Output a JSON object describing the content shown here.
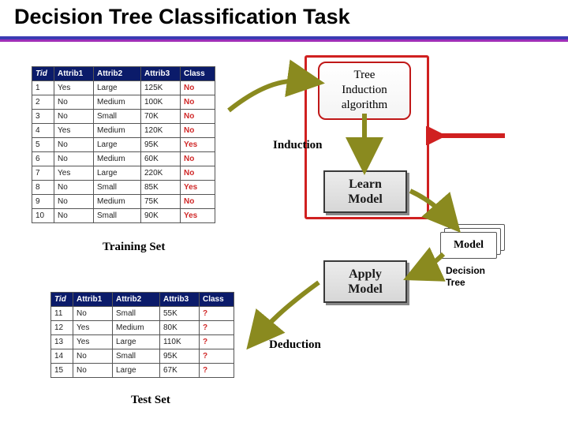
{
  "title": "Decision Tree Classification Task",
  "headers": {
    "tid": "Tid",
    "a1": "Attrib1",
    "a2": "Attrib2",
    "a3": "Attrib3",
    "cls": "Class"
  },
  "training": {
    "caption": "Training Set",
    "rows": [
      {
        "tid": "1",
        "a1": "Yes",
        "a2": "Large",
        "a3": "125K",
        "cls": "No"
      },
      {
        "tid": "2",
        "a1": "No",
        "a2": "Medium",
        "a3": "100K",
        "cls": "No"
      },
      {
        "tid": "3",
        "a1": "No",
        "a2": "Small",
        "a3": "70K",
        "cls": "No"
      },
      {
        "tid": "4",
        "a1": "Yes",
        "a2": "Medium",
        "a3": "120K",
        "cls": "No"
      },
      {
        "tid": "5",
        "a1": "No",
        "a2": "Large",
        "a3": "95K",
        "cls": "Yes"
      },
      {
        "tid": "6",
        "a1": "No",
        "a2": "Medium",
        "a3": "60K",
        "cls": "No"
      },
      {
        "tid": "7",
        "a1": "Yes",
        "a2": "Large",
        "a3": "220K",
        "cls": "No"
      },
      {
        "tid": "8",
        "a1": "No",
        "a2": "Small",
        "a3": "85K",
        "cls": "Yes"
      },
      {
        "tid": "9",
        "a1": "No",
        "a2": "Medium",
        "a3": "75K",
        "cls": "No"
      },
      {
        "tid": "10",
        "a1": "No",
        "a2": "Small",
        "a3": "90K",
        "cls": "Yes"
      }
    ]
  },
  "test": {
    "caption": "Test Set",
    "rows": [
      {
        "tid": "11",
        "a1": "No",
        "a2": "Small",
        "a3": "55K",
        "cls": "?"
      },
      {
        "tid": "12",
        "a1": "Yes",
        "a2": "Medium",
        "a3": "80K",
        "cls": "?"
      },
      {
        "tid": "13",
        "a1": "Yes",
        "a2": "Large",
        "a3": "110K",
        "cls": "?"
      },
      {
        "tid": "14",
        "a1": "No",
        "a2": "Small",
        "a3": "95K",
        "cls": "?"
      },
      {
        "tid": "15",
        "a1": "No",
        "a2": "Large",
        "a3": "67K",
        "cls": "?"
      }
    ]
  },
  "algo": {
    "line1": "Tree",
    "line2": "Induction",
    "line3": "algorithm"
  },
  "learn": {
    "line1": "Learn",
    "line2": "Model"
  },
  "apply": {
    "line1": "Apply",
    "line2": "Model"
  },
  "model_label": "Model",
  "induction_label": "Induction",
  "deduction_label": "Deduction",
  "decision_tree": {
    "line1": "Decision",
    "line2": "Tree"
  }
}
